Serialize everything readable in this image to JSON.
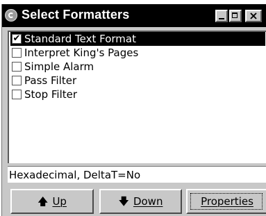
{
  "window": {
    "title": "Select Formatters"
  },
  "formatters": [
    {
      "label": "Standard Text Format",
      "checked": true,
      "selected": true
    },
    {
      "label": "Interpret King's Pages",
      "checked": false,
      "selected": false
    },
    {
      "label": "Simple Alarm",
      "checked": false,
      "selected": false
    },
    {
      "label": "Pass Filter",
      "checked": false,
      "selected": false
    },
    {
      "label": "Stop Filter",
      "checked": false,
      "selected": false
    }
  ],
  "status": "Hexadecimal, DeltaT=No",
  "buttons": {
    "up": {
      "label": "Up",
      "icon": "arrow-up-icon",
      "glyph": "🡅"
    },
    "down": {
      "label": "Down",
      "icon": "arrow-down-icon",
      "glyph": "🡇"
    },
    "properties": {
      "label": "Properties"
    }
  }
}
